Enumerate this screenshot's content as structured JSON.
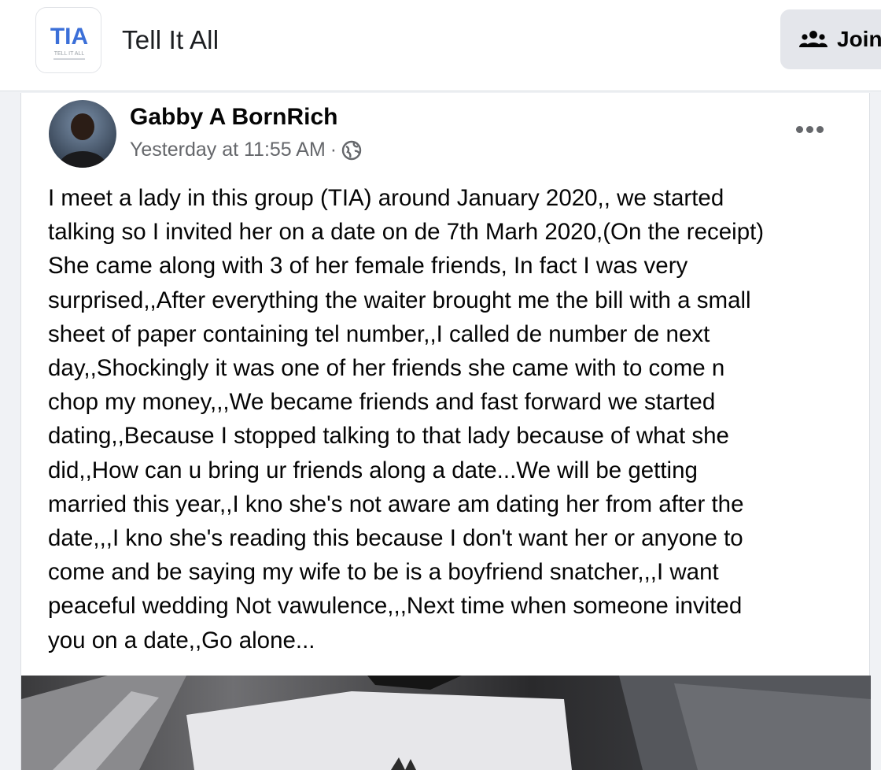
{
  "group": {
    "name": "Tell It All",
    "logo_text": "TIA",
    "logo_caption": "TELL IT ALL",
    "join_label": "Join"
  },
  "post": {
    "author": "Gabby A BornRich",
    "timestamp": "Yesterday at 11:55 AM",
    "separator": "·",
    "privacy_icon": "globe-icon",
    "body_lines": [
      "I meet a lady in this group (TIA) around January 2020,, we started",
      "talking so I invited her on a date on de 7th Marh 2020,(On the receipt)",
      "She came along with 3 of her female friends, In fact I was very",
      "surprised,,After everything the waiter brought me the bill with a small",
      "sheet of paper containing tel number,,I called de number de next",
      "day,,Shockingly it was one of her friends she came with to come n",
      "chop my money,,,We became friends and fast forward we started",
      "dating,,Because I stopped talking to that lady because of what she",
      "did,,How can u bring ur friends along a date...We will be getting",
      "married this year,,I kno she's not aware am dating her from after the",
      "date,,,I kno she's reading this because I don't want her or  anyone to",
      "come and be saying my wife to be is a boyfriend snatcher,,,I want",
      "peaceful wedding Not vawulence,,,Next time when someone invited",
      "you on a date,,Go alone..."
    ]
  },
  "colors": {
    "background": "#f0f2f5",
    "card": "#ffffff",
    "secondary_text": "#65676b",
    "button_gray": "#e4e6eb",
    "logo_blue": "#3b6fd8",
    "logo_pink": "#e0338f"
  },
  "icons": {
    "join": "group-people-icon",
    "more": "more-dots-icon"
  }
}
